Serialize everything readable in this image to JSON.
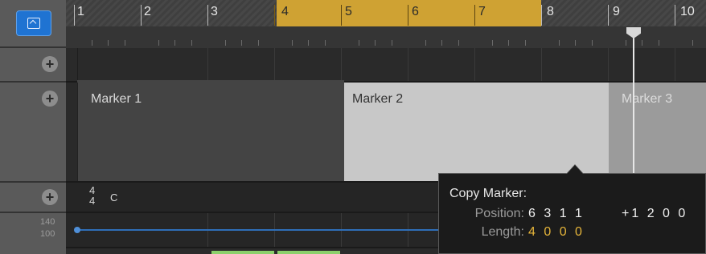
{
  "ruler": {
    "bars": [
      "1",
      "2",
      "3",
      "4",
      "5",
      "6",
      "7",
      "8",
      "9",
      "10"
    ],
    "cycle_color": "#cfa233"
  },
  "left": {
    "tempo_values": [
      "140",
      "100"
    ],
    "add_label": "+"
  },
  "markers": {
    "items": [
      {
        "label": "Marker 1"
      },
      {
        "label": "Marker 2"
      },
      {
        "label": "Marker 3"
      }
    ]
  },
  "signature": {
    "numerator": "4",
    "denominator": "4",
    "key": "C"
  },
  "tooltip": {
    "title": "Copy Marker:",
    "position_label": "Position:",
    "position_value": "6 3 1 1",
    "offset_value": "+1 2 0 0",
    "length_label": "Length:",
    "length_value": "4 0 0 0"
  },
  "colors": {
    "accent": "#1f73d2",
    "highlight": "#e7b63a",
    "tempo_line": "#2f6fb8"
  }
}
